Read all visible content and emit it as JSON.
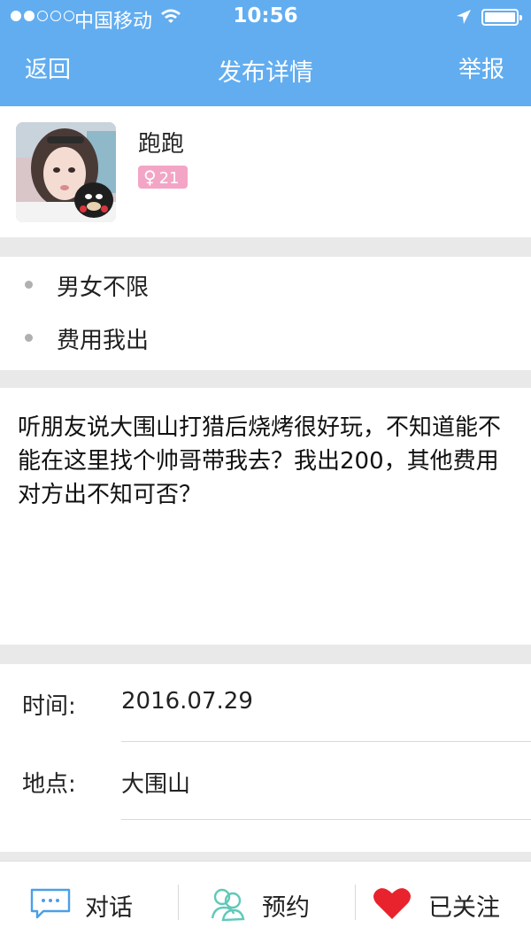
{
  "status_bar": {
    "carrier": "中国移动",
    "time": "10:56",
    "signal_dots": [
      true,
      true,
      false,
      false,
      false
    ]
  },
  "nav": {
    "back_label": "返回",
    "title": "发布详情",
    "report_label": "举报"
  },
  "user": {
    "name": "跑跑",
    "gender_symbol": "♀",
    "age": "21",
    "badge_color": "#f3a5c6"
  },
  "tags": [
    "男女不限",
    "费用我出"
  ],
  "description": "听朋友说大围山打猎后烧烤很好玩，不知道能不能在这里找个帅哥带我去？我出200，其他费用对方出不知可否？",
  "info": {
    "time_label": "时间:",
    "time_value": "2016.07.29",
    "place_label": "地点:",
    "place_value": "大围山"
  },
  "bottom_bar": {
    "chat_label": "对话",
    "book_label": "预约",
    "follow_label": "已关注"
  },
  "colors": {
    "accent": "#62adf0",
    "heart": "#e8232d",
    "teal": "#5fc9d0"
  }
}
